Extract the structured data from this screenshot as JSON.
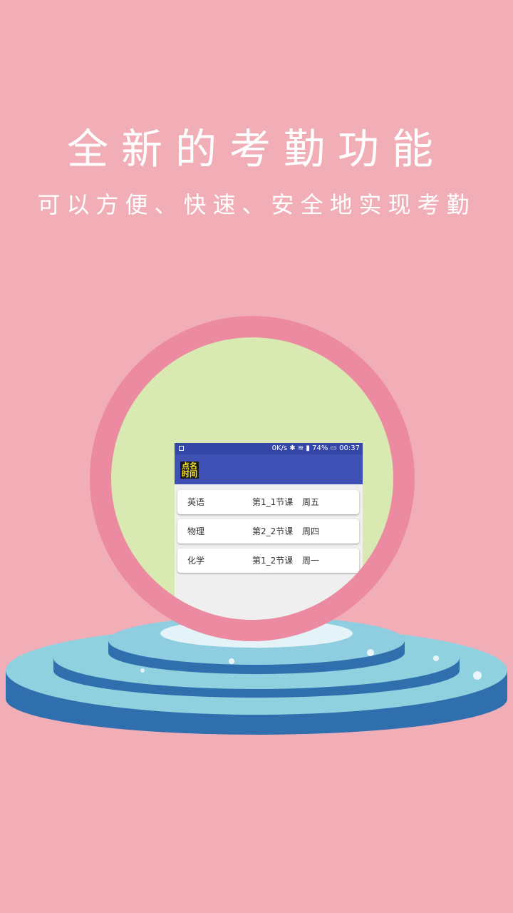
{
  "headline": "全新的考勤功能",
  "subline": "可以方便、快速、安全地实现考勤",
  "colors": {
    "background": "#f2aeb7",
    "ring": "#ec8aa2",
    "disc": "#d8e9b1",
    "appbar": "#3f51b5",
    "pedestal_top": "#90d1e0",
    "pedestal_side": "#2f6fae"
  },
  "phone": {
    "status": {
      "speed": "0K/s",
      "battery": "74%",
      "time": "00:37"
    },
    "app_icon_text": [
      "点名",
      "时间"
    ],
    "rows": [
      {
        "subject": "英语",
        "period": "第1_1节课",
        "day": "周五"
      },
      {
        "subject": "物理",
        "period": "第2_2节课",
        "day": "周四"
      },
      {
        "subject": "化学",
        "period": "第1_2节课",
        "day": "周一"
      }
    ]
  }
}
